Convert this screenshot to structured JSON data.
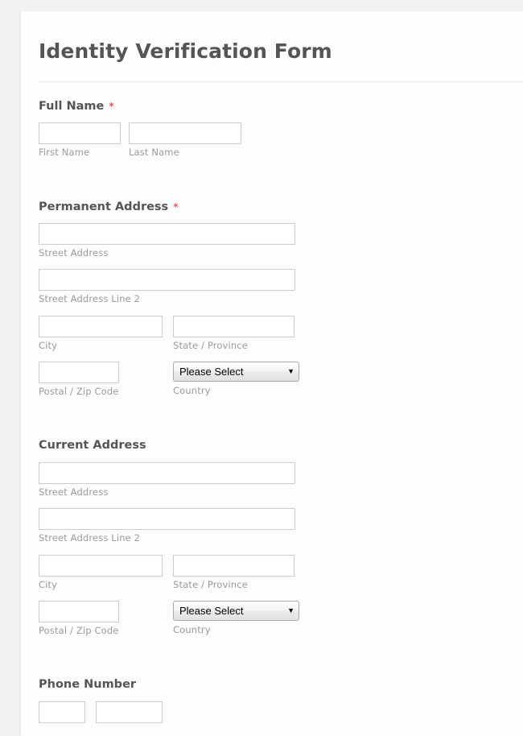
{
  "form": {
    "title": "Identity Verification Form",
    "required_marker": "*",
    "accent_required_color": "#e35b5b",
    "label_color": "#555555",
    "sublabel_color": "#9a9a9a",
    "field_border_color": "#ccccd0",
    "page_background": "#f2f2f2",
    "card_background": "#fdfdfd"
  },
  "full_name": {
    "label": "Full Name",
    "required": true,
    "first": {
      "value": "",
      "sublabel": "First Name"
    },
    "last": {
      "value": "",
      "sublabel": "Last Name"
    }
  },
  "permanent_address": {
    "label": "Permanent Address",
    "required": true,
    "street": {
      "value": "",
      "sublabel": "Street Address"
    },
    "street2": {
      "value": "",
      "sublabel": "Street Address Line 2"
    },
    "city": {
      "value": "",
      "sublabel": "City"
    },
    "state": {
      "value": "",
      "sublabel": "State / Province"
    },
    "postal": {
      "value": "",
      "sublabel": "Postal / Zip Code"
    },
    "country": {
      "selected": "Please Select",
      "sublabel": "Country",
      "arrow": "▼"
    }
  },
  "current_address": {
    "label": "Current Address",
    "required": false,
    "street": {
      "value": "",
      "sublabel": "Street Address"
    },
    "street2": {
      "value": "",
      "sublabel": "Street Address Line 2"
    },
    "city": {
      "value": "",
      "sublabel": "City"
    },
    "state": {
      "value": "",
      "sublabel": "State / Province"
    },
    "postal": {
      "value": "",
      "sublabel": "Postal / Zip Code"
    },
    "country": {
      "selected": "Please Select",
      "sublabel": "Country",
      "arrow": "▼"
    }
  },
  "phone_number": {
    "label": "Phone Number",
    "required": false,
    "area": {
      "value": ""
    },
    "number": {
      "value": ""
    }
  }
}
